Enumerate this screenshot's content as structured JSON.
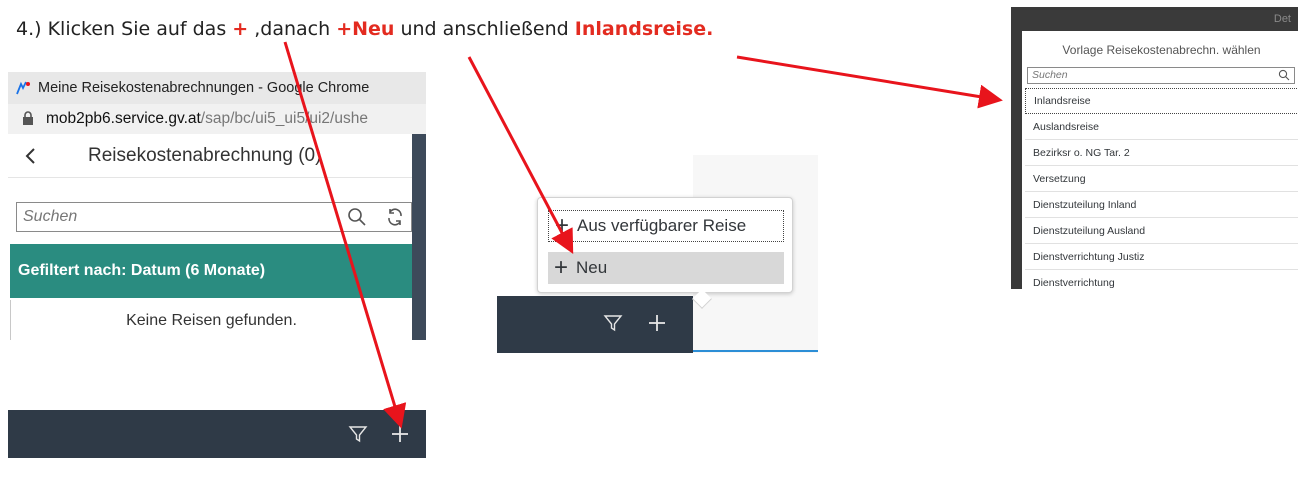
{
  "instruction": {
    "prefix": "4.) Klicken Sie auf das ",
    "plus": "+",
    "middle": " ,danach ",
    "neu": "+Neu",
    "and": " und anschließend ",
    "inland": "Inlandsreise."
  },
  "panel1": {
    "window_title": "Meine Reisekostenabrechnungen - Google Chrome",
    "url_host": "mob2pb6.service.gv.at",
    "url_path": "/sap/bc/ui5_ui5/ui2/ushe",
    "header_title": "Reisekostenabrechnung (0)",
    "search_placeholder": "Suchen",
    "filter_text": "Gefiltert nach: Datum (6 Monate)",
    "empty_text": "Keine Reisen gefunden."
  },
  "panel2": {
    "menu_items": [
      "Aus verfügbarer Reise",
      "Neu"
    ]
  },
  "panel3": {
    "corner_text": "Det",
    "dialog_title": "Vorlage Reisekostenabrechn. wählen",
    "search_placeholder": "Suchen",
    "items": [
      "Inlandsreise",
      "Auslandsreise",
      "Bezirksr o. NG Tar. 2",
      "Versetzung",
      "Dienstzuteilung Inland",
      "Dienstzuteilung Ausland",
      "Dienstverrichtung Justiz",
      "Dienstverrichtung"
    ]
  },
  "icons": [
    "app-icon",
    "lock-icon",
    "back-chevron-icon",
    "search-icon",
    "refresh-icon",
    "filter-icon",
    "plus-icon"
  ],
  "colors": {
    "accent_red": "#e32b20",
    "filter_bar": "#2a8c80",
    "toolbar": "#2f3a47",
    "annotation_arrow": "#e8141c"
  }
}
